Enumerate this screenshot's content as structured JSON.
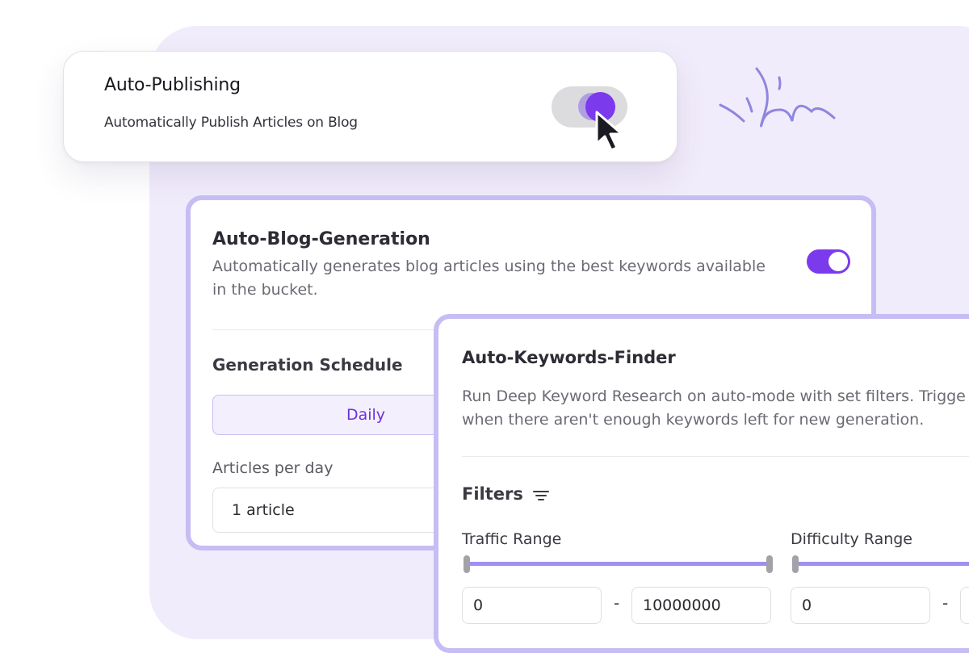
{
  "auto_publishing": {
    "title": "Auto-Publishing",
    "description": "Automatically Publish Articles on Blog",
    "enabled": true
  },
  "auto_blog_generation": {
    "title": "Auto-Blog-Generation",
    "description": "Automatically generates blog articles using the best keywords available in the bucket.",
    "enabled": true,
    "schedule_label": "Generation Schedule",
    "schedule_option": "Daily",
    "articles_label": "Articles per day",
    "articles_value": "1 article"
  },
  "auto_keywords_finder": {
    "title": "Auto-Keywords-Finder",
    "description_line1": "Run Deep Keyword Research on auto-mode with set filters. Trigge",
    "description_line2": "when there aren't enough keywords left for new generation.",
    "filters_label": "Filters",
    "traffic_range": {
      "label": "Traffic Range",
      "min": "0",
      "max": "10000000",
      "separator": "-"
    },
    "difficulty_range": {
      "label": "Difficulty Range",
      "min": "0",
      "separator": "-"
    }
  },
  "colors": {
    "accent": "#7c3aed",
    "card_border": "#c6bdf4",
    "background_panel": "#f1ecfb"
  },
  "icons": [
    "cursor-icon",
    "filter-icon",
    "squiggle-decoration"
  ]
}
